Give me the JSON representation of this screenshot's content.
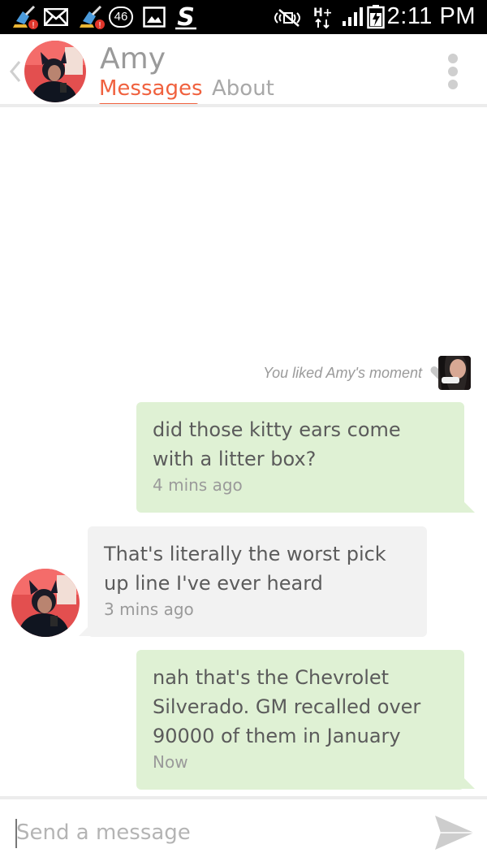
{
  "status_bar": {
    "badge_count": "46",
    "time": "2:11 PM",
    "network": "H+"
  },
  "header": {
    "name": "Amy",
    "tabs": [
      {
        "label": "Messages",
        "active": true
      },
      {
        "label": "About",
        "active": false
      }
    ]
  },
  "activity": {
    "liked_text": "You liked Amy's moment"
  },
  "messages": [
    {
      "direction": "outgoing",
      "text_lines": [
        "did those kitty ears come",
        "with a litter box?"
      ],
      "time": "4 mins ago"
    },
    {
      "direction": "incoming",
      "text_lines": [
        "That's literally the worst pick",
        "up line I've ever heard"
      ],
      "time": "3 mins ago"
    },
    {
      "direction": "outgoing",
      "text_lines": [
        "nah that's the Chevrolet",
        "Silverado. GM recalled over",
        "90000 of them in January"
      ],
      "time": "Now"
    }
  ],
  "composer": {
    "placeholder": "Send a message"
  },
  "colors": {
    "accent": "#f0613e",
    "outgoing_bubble": "#dff1d4",
    "incoming_bubble": "#f2f2f2",
    "name_gray": "#9a9a9a"
  }
}
